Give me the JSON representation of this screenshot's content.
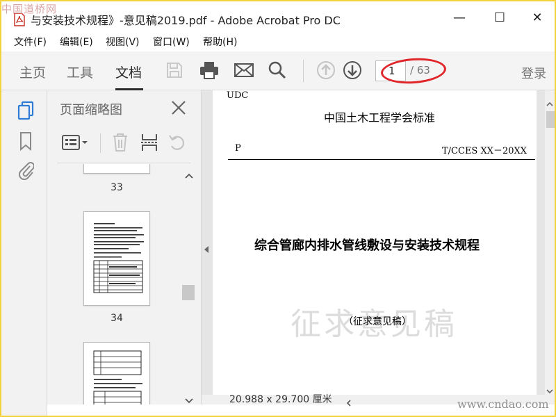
{
  "watermark_logo": "中国道桥网",
  "window": {
    "title": "与安装技术规程》-意见稿2019.pdf - Adobe Acrobat Pro DC",
    "minimize": "—",
    "maximize": "☐",
    "close": "✕"
  },
  "menu": [
    "文件(F)",
    "编辑(E)",
    "视图(V)",
    "窗口(W)",
    "帮助(H)"
  ],
  "toolbar": {
    "tabs": [
      "主页",
      "工具",
      "文档"
    ],
    "active_tab": "文档",
    "current_page": "1",
    "total_pages": "/ 63",
    "login": "登录"
  },
  "panel": {
    "title": "页面缩略图",
    "thumb_labels": [
      "33",
      "34"
    ]
  },
  "document": {
    "udc": "UDC",
    "org": "中国土木工程学会标准",
    "p_label": "P",
    "code": "T/CCES XX－20XX",
    "title": "综合管廊内排水管线敷设与安装技术规程",
    "draft_watermark": "征求意见稿",
    "draft_label": "（征求意见稿）"
  },
  "status": {
    "page_size": "20.988 x 29.700 厘米"
  },
  "site_watermark": "www.cndao.com",
  "colors": {
    "accent_blue": "#2f7bd6",
    "highlight_red": "#e0262a",
    "frame_yellow": "#f2d23a"
  },
  "icons": [
    "pdf-icon",
    "save-icon",
    "print-icon",
    "email-icon",
    "search-icon",
    "page-up-icon",
    "page-down-icon",
    "page-thumbnails-icon",
    "bookmark-icon",
    "attachment-icon",
    "options-icon",
    "delete-icon",
    "extract-icon",
    "rotate-icon",
    "close-icon"
  ]
}
